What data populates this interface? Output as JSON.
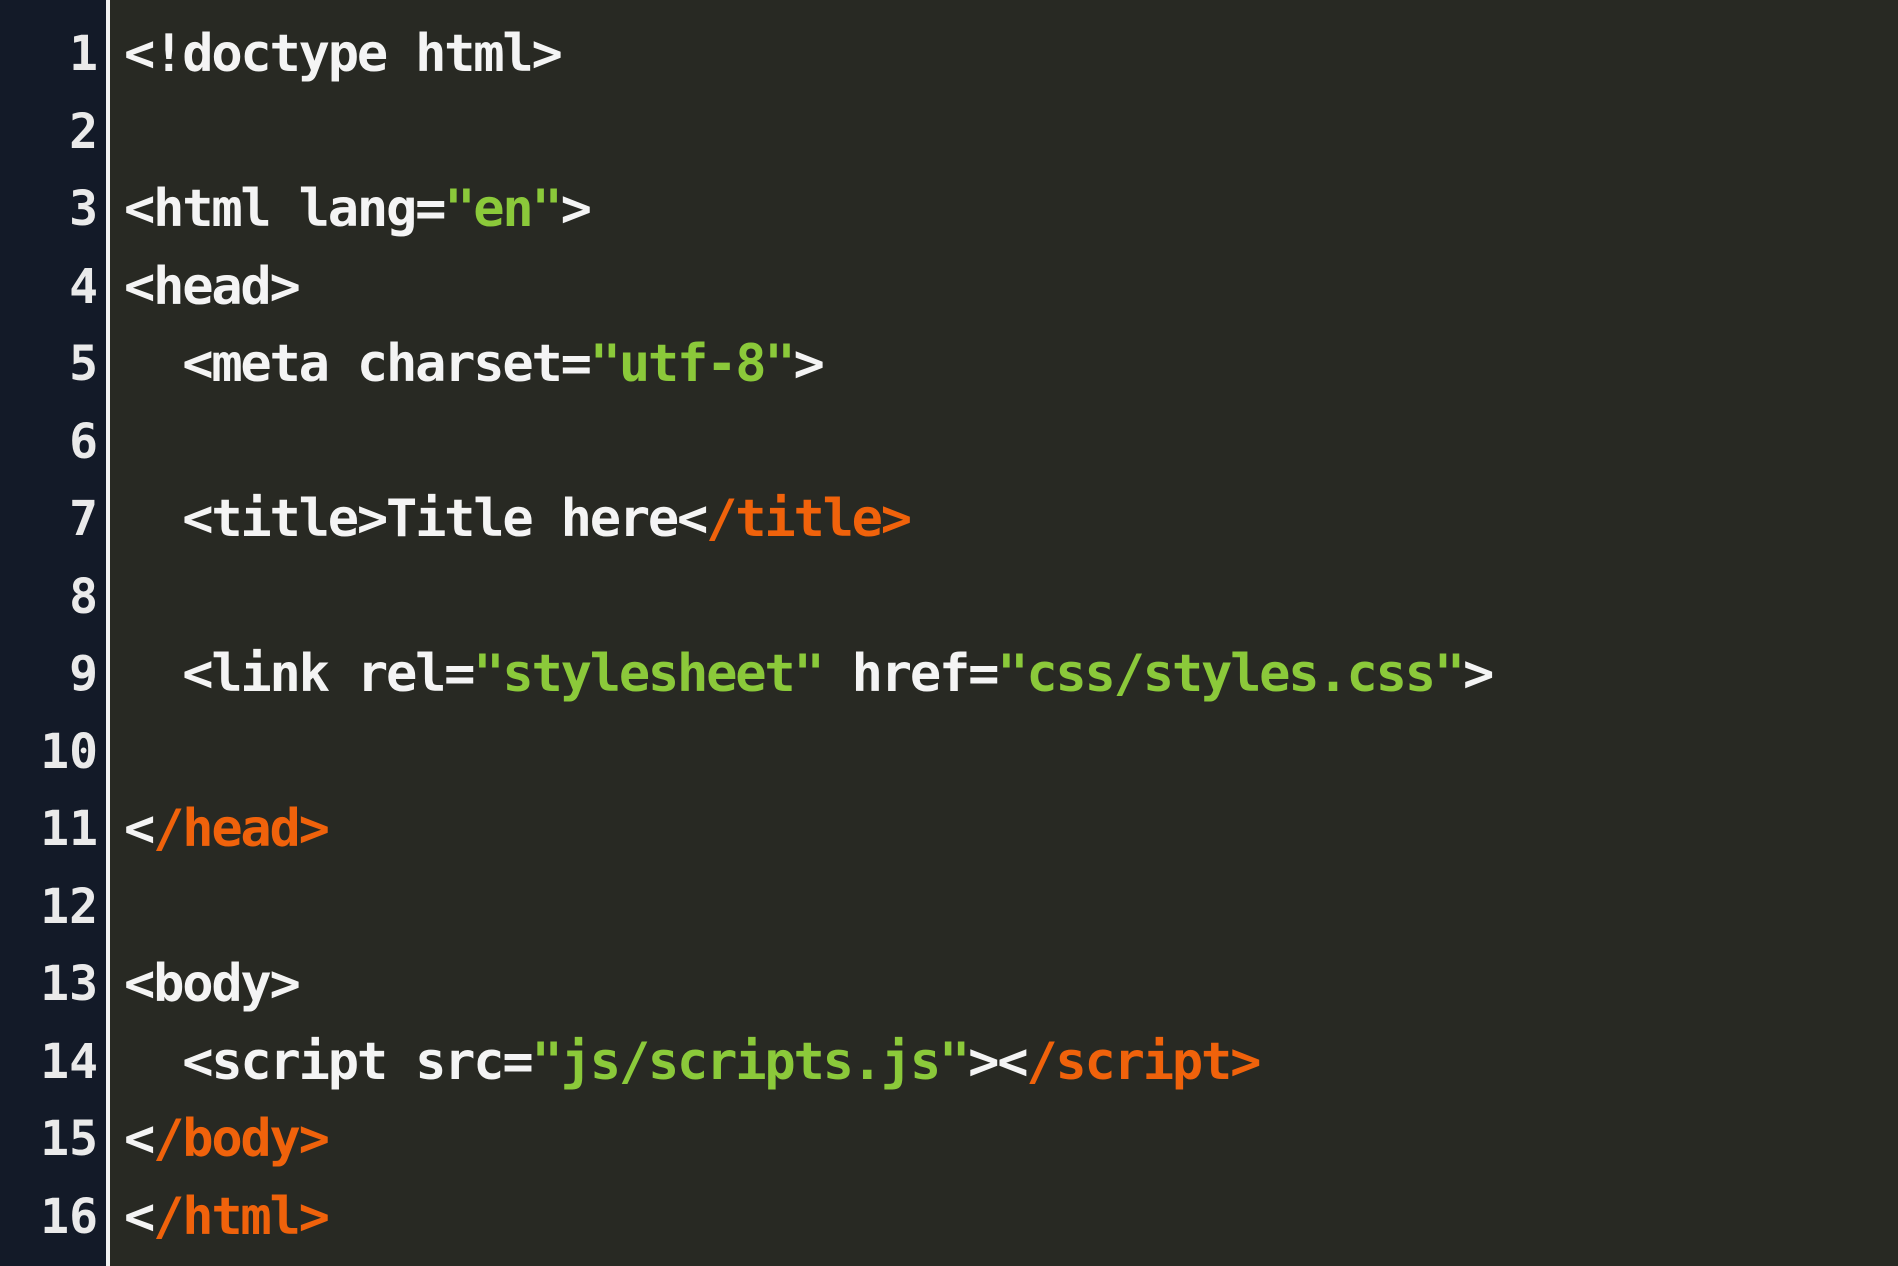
{
  "theme": {
    "background": "#282923",
    "gutter_background": "#131a28",
    "text_color": "#f4f4f4",
    "string_color": "#8bc93a",
    "closing_tag_color": "#f0620b"
  },
  "lines": [
    {
      "number": "1",
      "indent": "",
      "tokens": [
        {
          "type": "text",
          "value": "<!doctype html>"
        }
      ]
    },
    {
      "number": "2",
      "indent": "",
      "tokens": []
    },
    {
      "number": "3",
      "indent": "",
      "tokens": [
        {
          "type": "text",
          "value": "<html lang="
        },
        {
          "type": "str",
          "value": "\"en\""
        },
        {
          "type": "text",
          "value": ">"
        }
      ]
    },
    {
      "number": "4",
      "indent": "",
      "tokens": [
        {
          "type": "text",
          "value": "<head>"
        }
      ]
    },
    {
      "number": "5",
      "indent": "  ",
      "tokens": [
        {
          "type": "text",
          "value": "<meta charset="
        },
        {
          "type": "str",
          "value": "\"utf-8\""
        },
        {
          "type": "text",
          "value": ">"
        }
      ]
    },
    {
      "number": "6",
      "indent": "",
      "tokens": []
    },
    {
      "number": "7",
      "indent": "  ",
      "tokens": [
        {
          "type": "text",
          "value": "<title>Title here<"
        },
        {
          "type": "close",
          "value": "/title>"
        }
      ]
    },
    {
      "number": "8",
      "indent": "",
      "tokens": []
    },
    {
      "number": "9",
      "indent": "  ",
      "tokens": [
        {
          "type": "text",
          "value": "<link rel="
        },
        {
          "type": "str",
          "value": "\"stylesheet\""
        },
        {
          "type": "text",
          "value": " href="
        },
        {
          "type": "str",
          "value": "\"css/styles.css\""
        },
        {
          "type": "text",
          "value": ">"
        }
      ]
    },
    {
      "number": "10",
      "indent": "",
      "tokens": []
    },
    {
      "number": "11",
      "indent": "",
      "tokens": [
        {
          "type": "text",
          "value": "<"
        },
        {
          "type": "close",
          "value": "/head>"
        }
      ]
    },
    {
      "number": "12",
      "indent": "",
      "tokens": []
    },
    {
      "number": "13",
      "indent": "",
      "tokens": [
        {
          "type": "text",
          "value": "<body>"
        }
      ]
    },
    {
      "number": "14",
      "indent": "  ",
      "tokens": [
        {
          "type": "text",
          "value": "<script src="
        },
        {
          "type": "str",
          "value": "\"js/scripts.js\""
        },
        {
          "type": "text",
          "value": "><"
        },
        {
          "type": "close",
          "value": "/script>"
        }
      ]
    },
    {
      "number": "15",
      "indent": "",
      "tokens": [
        {
          "type": "text",
          "value": "<"
        },
        {
          "type": "close",
          "value": "/body>"
        }
      ]
    },
    {
      "number": "16",
      "indent": "",
      "tokens": [
        {
          "type": "text",
          "value": "<"
        },
        {
          "type": "close",
          "value": "/html>"
        }
      ]
    }
  ]
}
